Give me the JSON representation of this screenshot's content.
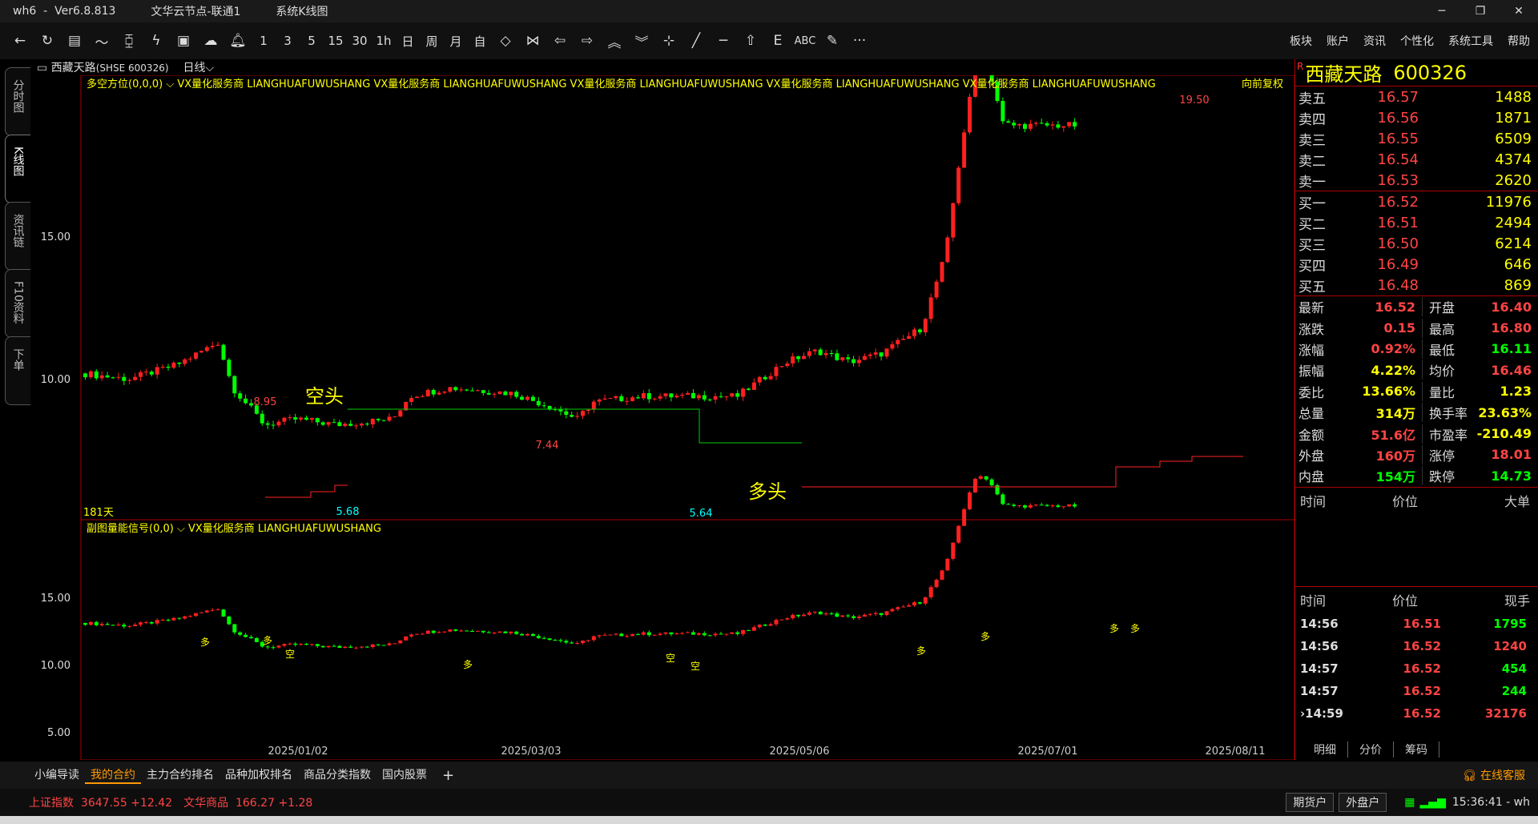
{
  "window": {
    "app": "wh6",
    "sep": "-",
    "version": "Ver6.8.813",
    "node": "文华云节点-联通1",
    "view": "系统K线图",
    "min": "─",
    "max": "❐",
    "close": "✕"
  },
  "toolbar": {
    "periods": [
      "1",
      "3",
      "5",
      "15",
      "30",
      "1h",
      "日",
      "周",
      "月",
      "自"
    ],
    "menu": [
      "板块",
      "账户",
      "资讯",
      "个性化",
      "系统工具",
      "帮助"
    ],
    "abc": "ABC",
    "more": "···"
  },
  "left_tabs": [
    "分时图",
    "K线图",
    "资讯链",
    "F10资料",
    "下单"
  ],
  "chart": {
    "stock_name": "西藏天路",
    "stock_code": "(SHSE 600326)",
    "period": "日线",
    "indicator_main": "多空方位(0,0,0)",
    "indicator_text": "VX量化服务商  LIANGHUAFUWUSHANG  VX量化服务商  LIANGHUAFUWUSHANG  VX量化服务商  LIANGHUAFUWUSHANG  VX量化服务商  LIANGHUAFUWUSHANG  VX量化服务商  LIANGHUAFUWUSHANG",
    "adjust": "向前复权",
    "days": "181天",
    "label_kong": "空头",
    "label_duo": "多头",
    "high_label": "19.50",
    "peak1_label": "8.95",
    "peak2_label": "7.44",
    "low1_label": "5.68",
    "low2_label": "5.64",
    "y_main": [
      "15.00",
      "10.00"
    ],
    "sub_indicator": "副图量能信号(0,0)",
    "sub_text": "VX量化服务商  LIANGHUAFUWUSHANG",
    "y_sub": [
      "15.00",
      "10.00",
      "5.00"
    ],
    "sig_duo": "多",
    "sig_kong": "空",
    "dates": [
      "2025/01/02",
      "2025/03/03",
      "2025/05/06",
      "2025/07/01",
      "2025/08/11"
    ]
  },
  "quote": {
    "name": "西藏天路",
    "code": "600326",
    "r": "R",
    "sell": [
      {
        "label": "卖五",
        "price": "16.57",
        "vol": "1488"
      },
      {
        "label": "卖四",
        "price": "16.56",
        "vol": "1871"
      },
      {
        "label": "卖三",
        "price": "16.55",
        "vol": "6509"
      },
      {
        "label": "卖二",
        "price": "16.54",
        "vol": "4374"
      },
      {
        "label": "卖一",
        "price": "16.53",
        "vol": "2620"
      }
    ],
    "buy": [
      {
        "label": "买一",
        "price": "16.52",
        "vol": "11976"
      },
      {
        "label": "买二",
        "price": "16.51",
        "vol": "2494"
      },
      {
        "label": "买三",
        "price": "16.50",
        "vol": "6214"
      },
      {
        "label": "买四",
        "price": "16.49",
        "vol": "646"
      },
      {
        "label": "买五",
        "price": "16.48",
        "vol": "869"
      }
    ],
    "stats": [
      {
        "l1": "最新",
        "v1": "16.52",
        "c1": "red",
        "l2": "开盘",
        "v2": "16.40",
        "c2": "red"
      },
      {
        "l1": "涨跌",
        "v1": "0.15",
        "c1": "red",
        "l2": "最高",
        "v2": "16.80",
        "c2": "red"
      },
      {
        "l1": "涨幅",
        "v1": "0.92%",
        "c1": "red",
        "l2": "最低",
        "v2": "16.11",
        "c2": "green"
      },
      {
        "l1": "振幅",
        "v1": "4.22%",
        "c1": "yellow",
        "l2": "均价",
        "v2": "16.46",
        "c2": "red"
      },
      {
        "l1": "委比",
        "v1": "13.66%",
        "c1": "yellow",
        "l2": "量比",
        "v2": "1.23",
        "c2": "yellow"
      },
      {
        "l1": "总量",
        "v1": "314万",
        "c1": "yellow",
        "l2": "换手率",
        "v2": "23.63%",
        "c2": "yellow"
      },
      {
        "l1": "金额",
        "v1": "51.6亿",
        "c1": "red",
        "l2": "市盈率",
        "v2": "-210.49",
        "c2": "yellow"
      },
      {
        "l1": "外盘",
        "v1": "160万",
        "c1": "red",
        "l2": "涨停",
        "v2": "18.01",
        "c2": "red"
      },
      {
        "l1": "内盘",
        "v1": "154万",
        "c1": "green",
        "l2": "跌停",
        "v2": "14.73",
        "c2": "green"
      }
    ],
    "big_head": [
      "时间",
      "价位",
      "大单"
    ],
    "tick_head": [
      "时间",
      "价位",
      "现手"
    ],
    "ticks": [
      {
        "time": "14:56",
        "price": "16.51",
        "vol": "1795",
        "c": "green"
      },
      {
        "time": "14:56",
        "price": "16.52",
        "vol": "1240",
        "c": "red"
      },
      {
        "time": "14:57",
        "price": "16.52",
        "vol": "454",
        "c": "green"
      },
      {
        "time": "14:57",
        "price": "16.52",
        "vol": "244",
        "c": "green"
      },
      {
        "time": "›14:59",
        "price": "16.52",
        "vol": "32176",
        "c": "red"
      }
    ],
    "bottom_tabs": [
      "明细",
      "分价",
      "筹码"
    ]
  },
  "status": {
    "tabs": [
      "小编导读",
      "我的合约",
      "主力合约排名",
      "品种加权排名",
      "商品分类指数",
      "国内股票"
    ],
    "plus": "+",
    "service": "在线客服",
    "idx1_name": "上证指数",
    "idx1_val": "3647.55",
    "idx1_chg": "+12.42",
    "idx2_name": "文华商品",
    "idx2_val": "166.27",
    "idx2_chg": "+1.28",
    "btn1": "期货户",
    "btn2": "外盘户",
    "clock": "15:36:41 - wh"
  },
  "colors": {
    "up": "#ff2020",
    "down": "#00ff00",
    "accent": "#ffff00",
    "frame": "#aa0000"
  }
}
